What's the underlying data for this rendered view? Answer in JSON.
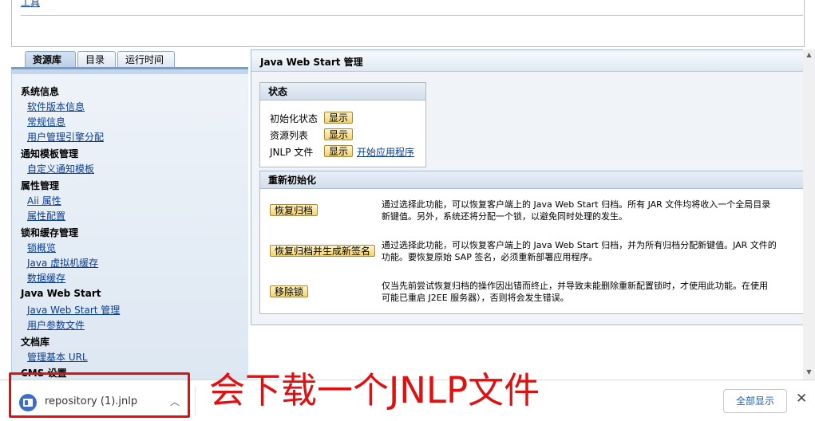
{
  "top": {
    "link": "工具"
  },
  "nav": {
    "tabs": [
      "资源库",
      "目录",
      "运行时间"
    ],
    "sections": [
      {
        "title": "系统信息",
        "links": [
          "软件版本信息",
          "常规信息",
          "用户管理引擎分配"
        ]
      },
      {
        "title": "通知模板管理",
        "links": [
          "自定义通知模板"
        ]
      },
      {
        "title": "属性管理",
        "links": [
          "Aii 属性",
          "属性配置"
        ]
      },
      {
        "title": "锁和缓存管理",
        "links": [
          "锁概览",
          "Java 虚拟机缓存",
          "数据缓存"
        ]
      },
      {
        "title": "Java Web Start",
        "links": [
          "Java Web Start 管理",
          "用户参数文件"
        ]
      },
      {
        "title": "文档库",
        "links": [
          "管理基本 URL"
        ]
      },
      {
        "title": "CMS 设置",
        "links": []
      }
    ]
  },
  "main": {
    "title": "Java Web Start 管理",
    "status": {
      "title": "状态",
      "rows": [
        {
          "label": "初始化状态",
          "button": "显示"
        },
        {
          "label": "资源列表",
          "button": "显示"
        },
        {
          "label": "JNLP 文件",
          "button": "显示",
          "link": "开始应用程序"
        }
      ]
    },
    "reinit": {
      "title": "重新初始化",
      "actions": [
        {
          "button": "恢复归档",
          "desc1": "通过选择此功能，可以恢复客户端上的 Java Web Start 归档。所有 JAR 文件均将收入一个全局目录",
          "desc2": "新键值。另外，系统还将分配一个锁，以避免同时处理的发生。"
        },
        {
          "button": "恢复归档并生成新签名",
          "desc1": "通过选择此功能，可以恢复客户端上的 Java Web Start 归档，并为所有归档分配新键值。JAR 文件的",
          "desc2": "功能。要恢复原始 SAP 签名，必须重新部署应用程序。"
        },
        {
          "button": "移除锁",
          "desc1": "仅当先前尝试恢复归档的操作因出错而终止，并导致未能删除重新配置锁时，才使用此功能。在使用",
          "desc2": "可能已重启 J2EE 服务器），否则将会发生错误。"
        }
      ]
    }
  },
  "download": {
    "file_name": "repository (1).jnlp",
    "annotation": "会下载一个JNLP文件",
    "show_all": "全部显示",
    "file_icon": "file-icon",
    "chevron": "chevron-up-icon",
    "close": "close-icon"
  },
  "colors": {
    "annotation": "#e01010",
    "link": "#0a3c8c",
    "button": "#f3d36f"
  }
}
